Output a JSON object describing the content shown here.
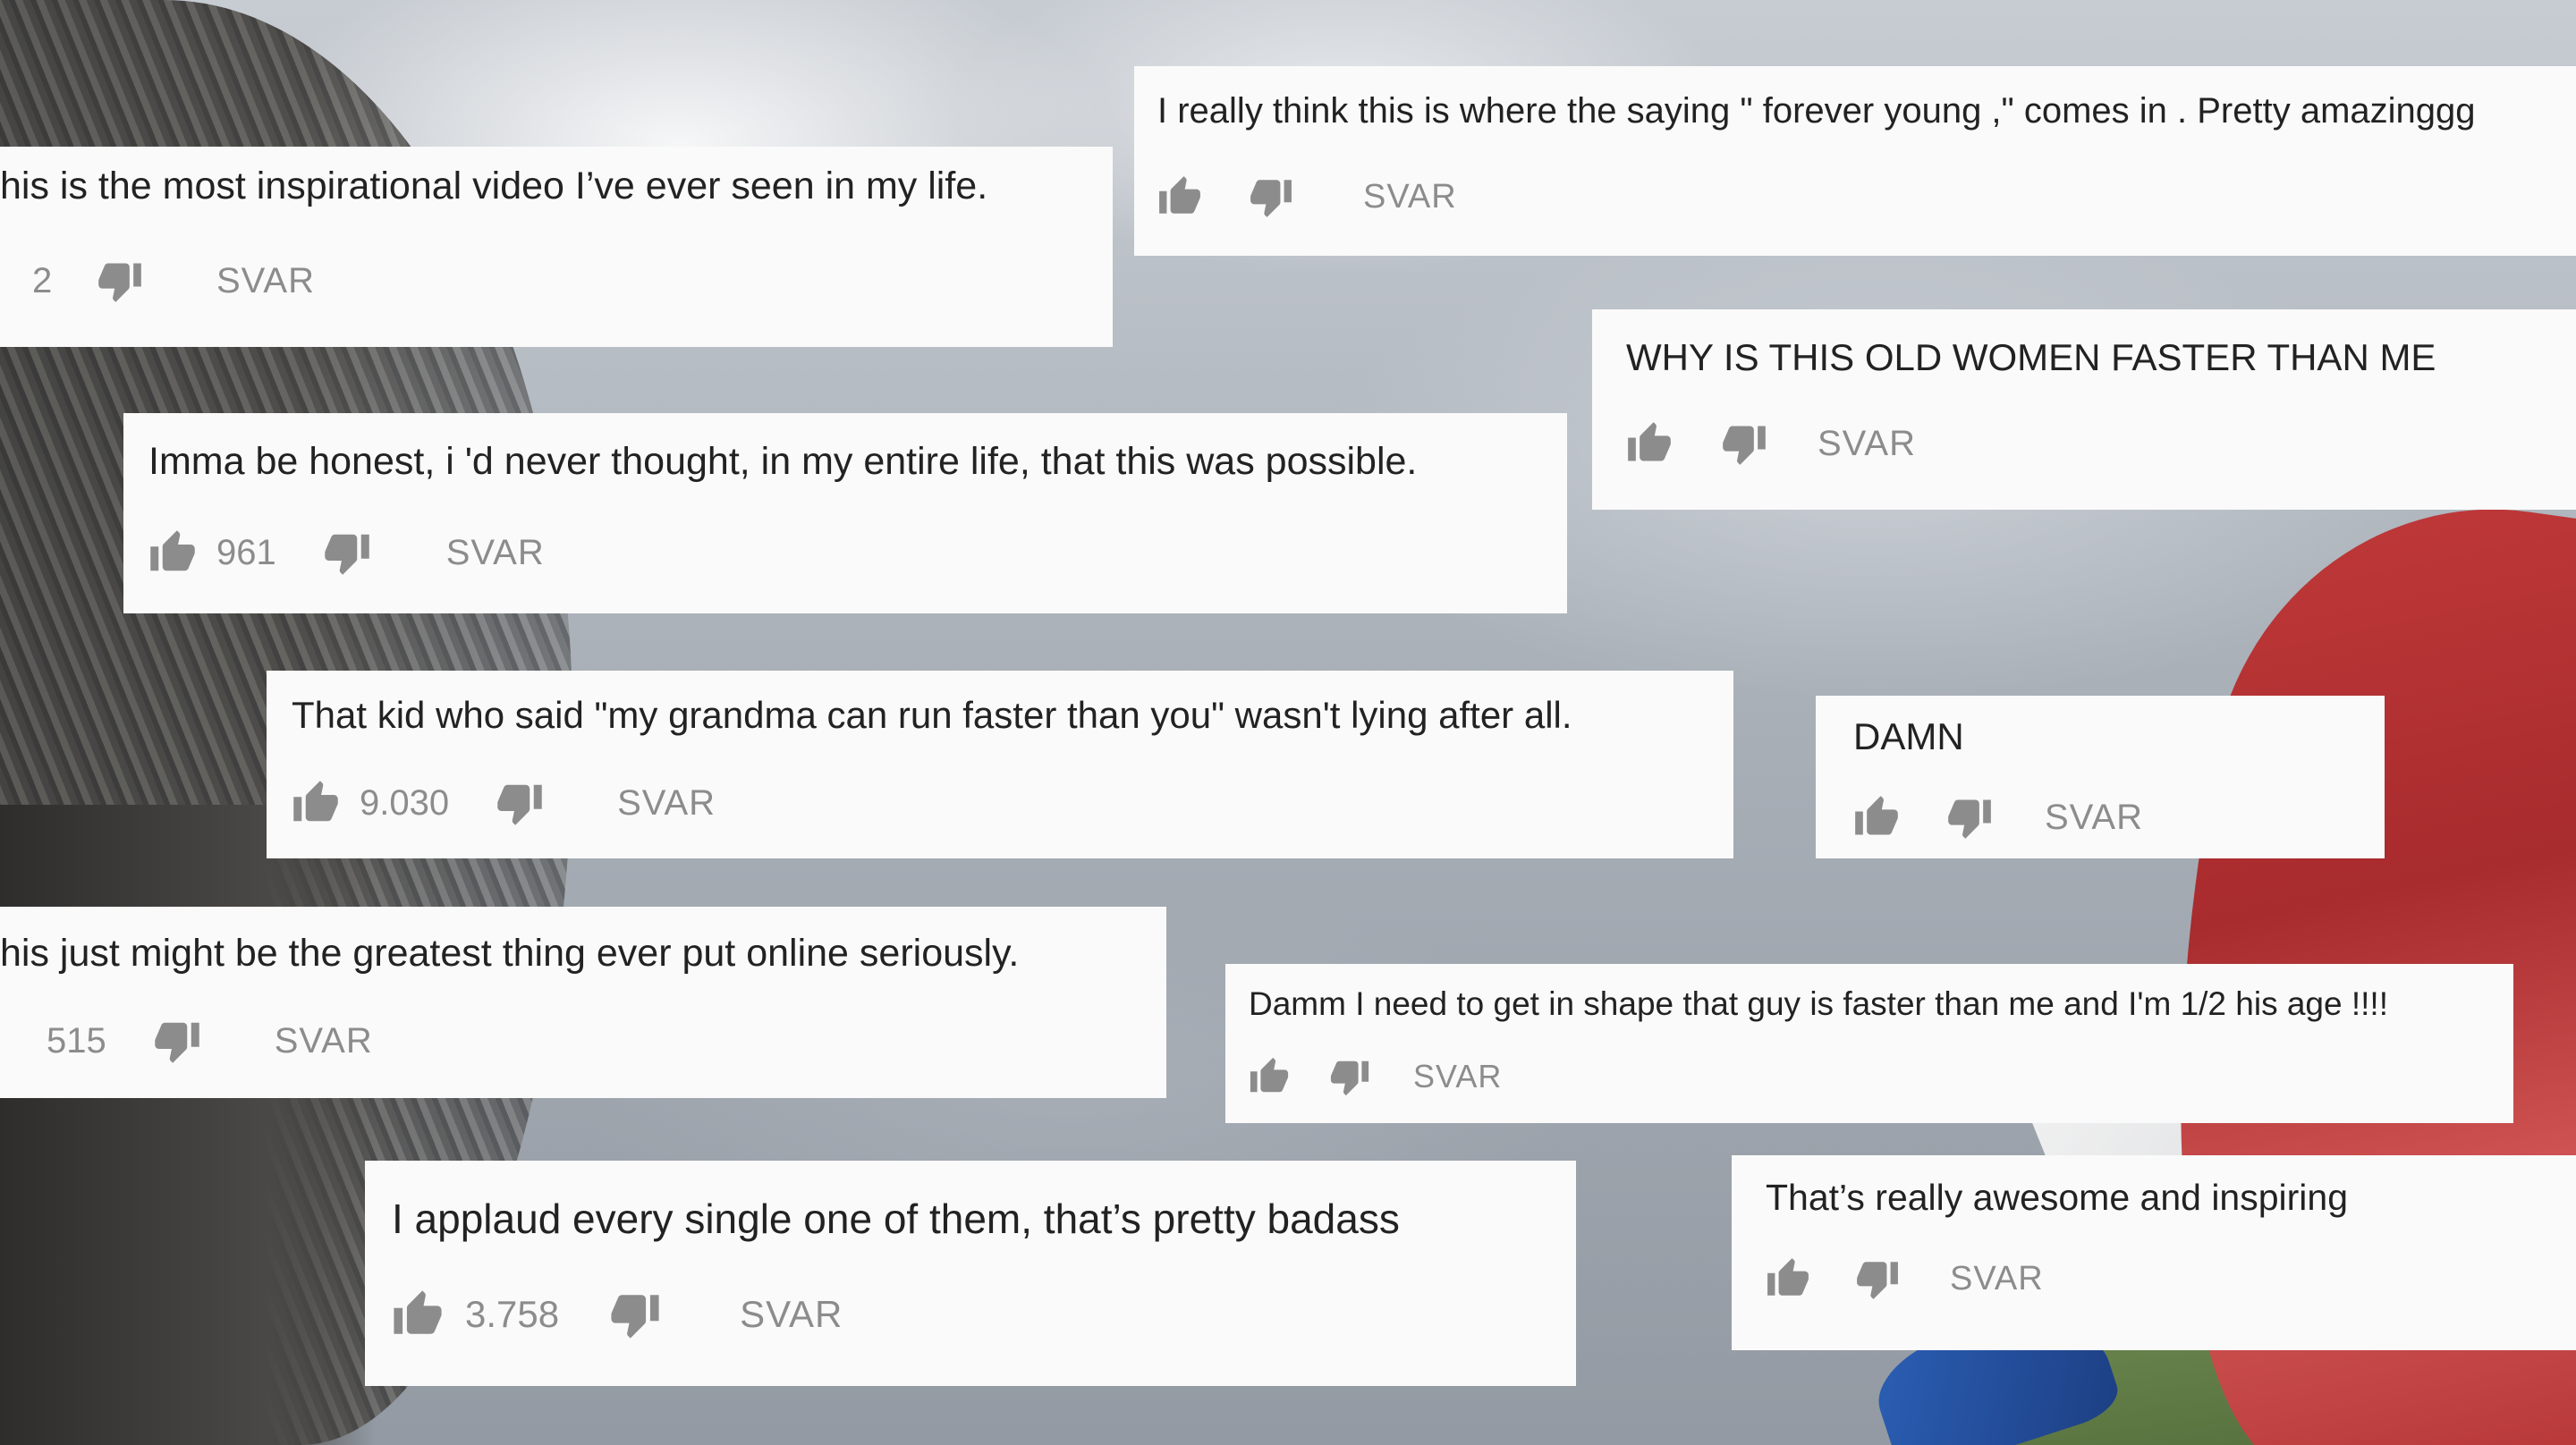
{
  "comments": [
    {
      "text": "his is the most inspirational video I’ve ever seen in my life.",
      "likes": "2",
      "reply": "SVAR"
    },
    {
      "text": "I really think this is where the saying \" forever young ,\" comes in . Pretty amazinggg",
      "likes": "",
      "reply": "SVAR"
    },
    {
      "text": "WHY IS THIS OLD WOMEN FASTER THAN ME",
      "likes": "",
      "reply": "SVAR"
    },
    {
      "text": "Imma be honest, i 'd never thought, in my entire life, that this was possible.",
      "likes": "961",
      "reply": "SVAR"
    },
    {
      "text": "That kid who said \"my grandma can run faster than you\" wasn't lying after all.",
      "likes": "9.030",
      "reply": "SVAR"
    },
    {
      "text": "DAMN",
      "likes": "",
      "reply": "SVAR"
    },
    {
      "text": "his just might be the greatest thing ever put online seriously.",
      "likes": "515",
      "reply": "SVAR"
    },
    {
      "text": "Damm I need to get in shape that guy is faster than me and I'm 1/2 his age !!!!",
      "likes": "",
      "reply": "SVAR"
    },
    {
      "text": "I applaud every single one of them, that’s pretty badass",
      "likes": "3.758",
      "reply": "SVAR"
    },
    {
      "text": "That’s really awesome and inspiring",
      "likes": "",
      "reply": "SVAR"
    }
  ],
  "icons": {
    "like": "thumbs-up-icon",
    "dislike": "thumbs-down-icon"
  },
  "colors": {
    "card_bg": "#fafafa",
    "text": "#222222",
    "muted": "#8c8c8c"
  }
}
